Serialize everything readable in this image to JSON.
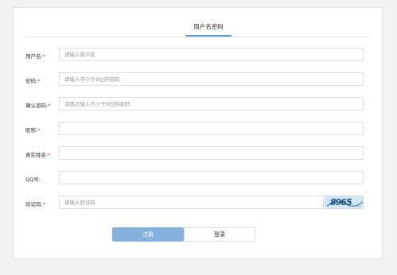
{
  "tabs": [
    {
      "label": "用户名密码"
    }
  ],
  "form": {
    "required_mark": "*",
    "fields": [
      {
        "label": "用户名:",
        "required": true,
        "placeholder": "请输入用户名"
      },
      {
        "label": "密码:",
        "required": true,
        "placeholder": "请输入不少于8位的密码"
      },
      {
        "label": "确认密码:",
        "required": true,
        "placeholder": "请再次输入不少于8位的密码"
      },
      {
        "label": "昵称:",
        "required": true,
        "placeholder": ""
      },
      {
        "label": "真实姓名:",
        "required": true,
        "placeholder": ""
      },
      {
        "label": "QQ号:",
        "required": false,
        "placeholder": ""
      },
      {
        "label": "验证码:",
        "required": true,
        "placeholder": "请输入验证码"
      }
    ],
    "captcha": {
      "text": "8965"
    }
  },
  "buttons": {
    "register": "注册",
    "login": "登录"
  },
  "colors": {
    "accent": "#5b9bd5",
    "primary_button": "#84b1de",
    "required": "#ee3333"
  }
}
